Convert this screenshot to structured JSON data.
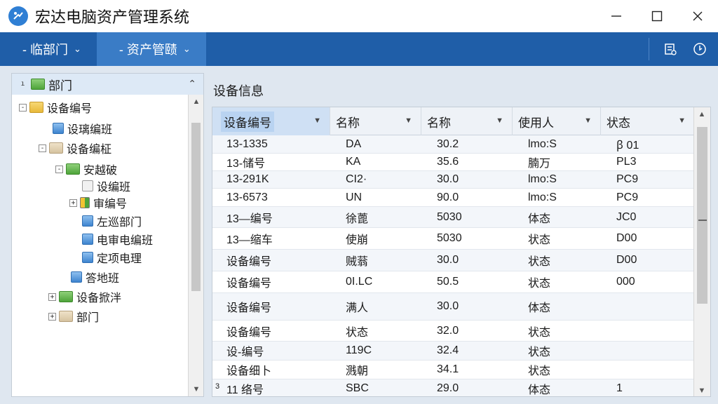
{
  "app": {
    "title": "宏达电脑资产管理系统"
  },
  "window": {
    "minimize": "—",
    "maximize": "☐",
    "close": "✕"
  },
  "menubar": {
    "items": [
      {
        "label": "- 临部门",
        "chevron": "⌄"
      },
      {
        "label": "- 资产管赜",
        "chevron": "⌄"
      }
    ]
  },
  "tree": {
    "header": "部门",
    "nodes": [
      {
        "label": "设备编号",
        "icon": "folder-yellow",
        "expander": "-"
      },
      {
        "label": "设璃编班",
        "icon": "doc-blue",
        "expander": ""
      },
      {
        "label": "设备编柾",
        "icon": "folder-beige",
        "expander": "-"
      },
      {
        "label": "安越破",
        "icon": "folder-green",
        "expander": "-"
      },
      {
        "label": "设编班",
        "icon": "doc-gray",
        "expander": ""
      },
      {
        "label": "审编号",
        "icon": "doc-flag",
        "expander": "+"
      },
      {
        "label": "左巡部门",
        "icon": "doc-blue",
        "expander": ""
      },
      {
        "label": "电审电编班",
        "icon": "doc-blue",
        "expander": ""
      },
      {
        "label": "定项电理",
        "icon": "doc-blue",
        "expander": ""
      },
      {
        "label": "答地班",
        "icon": "doc-blue",
        "expander": ""
      },
      {
        "label": "设备掀泮",
        "icon": "folder-green",
        "expander": "+"
      },
      {
        "label": "部门",
        "icon": "folder-beige",
        "expander": "+"
      }
    ]
  },
  "content": {
    "title": "设备信息",
    "columns": [
      "设备编号",
      "名称",
      "名称",
      "使用人",
      "状态"
    ],
    "rows": [
      [
        "13-1335",
        "DA",
        "30.2",
        "lmo:S",
        "ꞵ 01"
      ],
      [
        "13-储号",
        "KA",
        "35.6",
        "腩万",
        "PL3"
      ],
      [
        "13-291K",
        "CI2·",
        "30.0",
        "lmo:S",
        "PC9"
      ],
      [
        "13-6573",
        "UN",
        "90.0",
        "lmo:S",
        "PC9"
      ],
      [
        "13—编号",
        "徐蓖",
        "5030",
        "体态",
        "JC0"
      ],
      [
        "13—缩车",
        "使崩",
        "5030",
        "状态",
        "D00"
      ],
      [
        "设备编号",
        "贼蓊",
        "30.0",
        "状态",
        "D00"
      ],
      [
        "设备编号",
        "0I.LC",
        "50.5",
        "状态",
        "000"
      ],
      [
        "设备编号",
        "满人",
        "30.0",
        "体态",
        ""
      ],
      [
        "设备编号",
        "状态",
        "32.0",
        "状态",
        ""
      ],
      [
        "设-编号",
        "119C",
        "32.4",
        "状态",
        ""
      ],
      [
        "设备细卜",
        "溅朝",
        "34.1",
        "状态",
        ""
      ],
      [
        "11 络号",
        "SBC",
        "29.0",
        "体态",
        "1"
      ]
    ],
    "partial_row_prefix": "3"
  }
}
